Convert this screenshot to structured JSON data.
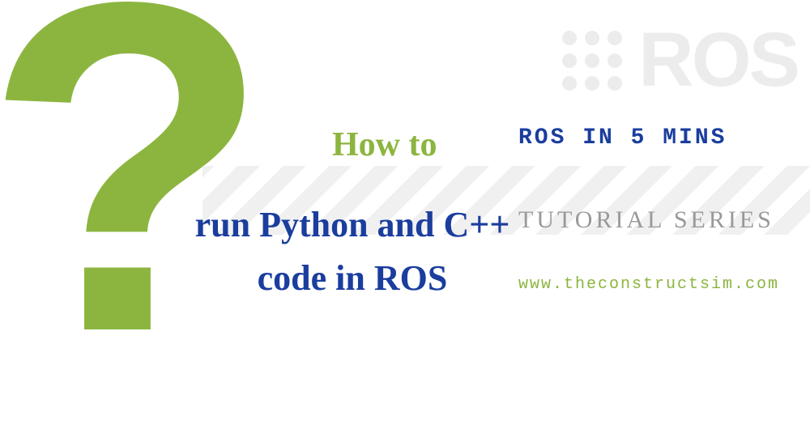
{
  "howTo": "How to",
  "mainTitle": "run Python and C++ code in ROS",
  "seriesTitle": "ROS IN 5 MINS",
  "tutorialSeries": "TUTORIAL SERIES",
  "website": "www.theconstructsim.com",
  "rosWatermark": "ROS",
  "questionMark": "?"
}
